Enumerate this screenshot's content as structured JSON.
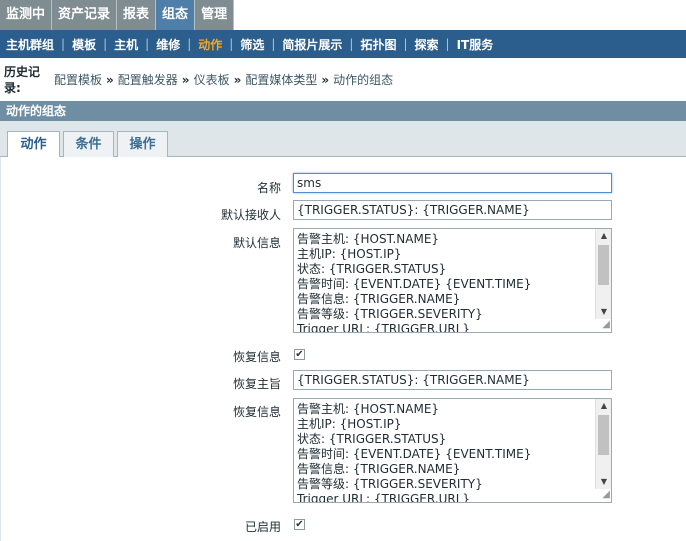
{
  "top_menu": [
    "监测中",
    "资产记录",
    "报表",
    "组态",
    "管理"
  ],
  "sub_menu": [
    "主机群组",
    "模板",
    "主机",
    "维修",
    "动作",
    "筛选",
    "简报片展示",
    "拓扑图",
    "探索",
    "IT服务"
  ],
  "history": {
    "label": "历史记录:",
    "crumbs": [
      "配置模板",
      "配置触发器",
      "仪表板",
      "配置媒体类型",
      "动作的组态"
    ],
    "arrow": "»"
  },
  "section_title": "动作的组态",
  "tabs": [
    "动作",
    "条件",
    "操作"
  ],
  "form": {
    "name_label": "名称",
    "name_value": "sms",
    "default_recipient_label": "默认接收人",
    "default_recipient_value": "{TRIGGER.STATUS}: {TRIGGER.NAME}",
    "default_message_label": "默认信息",
    "default_message_lines": [
      "告警主机: {HOST.NAME}",
      "主机IP: {HOST.IP}",
      "状态: {TRIGGER.STATUS}",
      "告警时间: {EVENT.DATE} {EVENT.TIME}",
      "告警信息: {TRIGGER.NAME}",
      "告警等级: {TRIGGER.SEVERITY}",
      "Trigger URL: {TRIGGER.URL}"
    ],
    "recovery_message_label": "恢复信息",
    "recovery_message_checked": true,
    "recovery_subject_label": "恢复主旨",
    "recovery_subject_value": "{TRIGGER.STATUS}: {TRIGGER.NAME}",
    "recovery_info_label": "恢复信息",
    "recovery_info_lines": [
      "告警主机: {HOST.NAME}",
      "主机IP: {HOST.IP}",
      "状态: {TRIGGER.STATUS}",
      "告警时间: {EVENT.DATE} {EVENT.TIME}",
      "告警信息: {TRIGGER.NAME}",
      "告警等级: {TRIGGER.SEVERITY}",
      "Trigger URL: {TRIGGER.URL}"
    ],
    "enabled_label": "已启用",
    "enabled_checked": true,
    "check_glyph": "✔"
  },
  "colors": {
    "top_menu_bg": "#7f8c92",
    "top_menu_active": "#4f7fa8",
    "sub_menu_bg": "#2b5e8c",
    "sub_menu_active_text": "#f5a623",
    "section_header_bg": "#6f8ea3"
  }
}
